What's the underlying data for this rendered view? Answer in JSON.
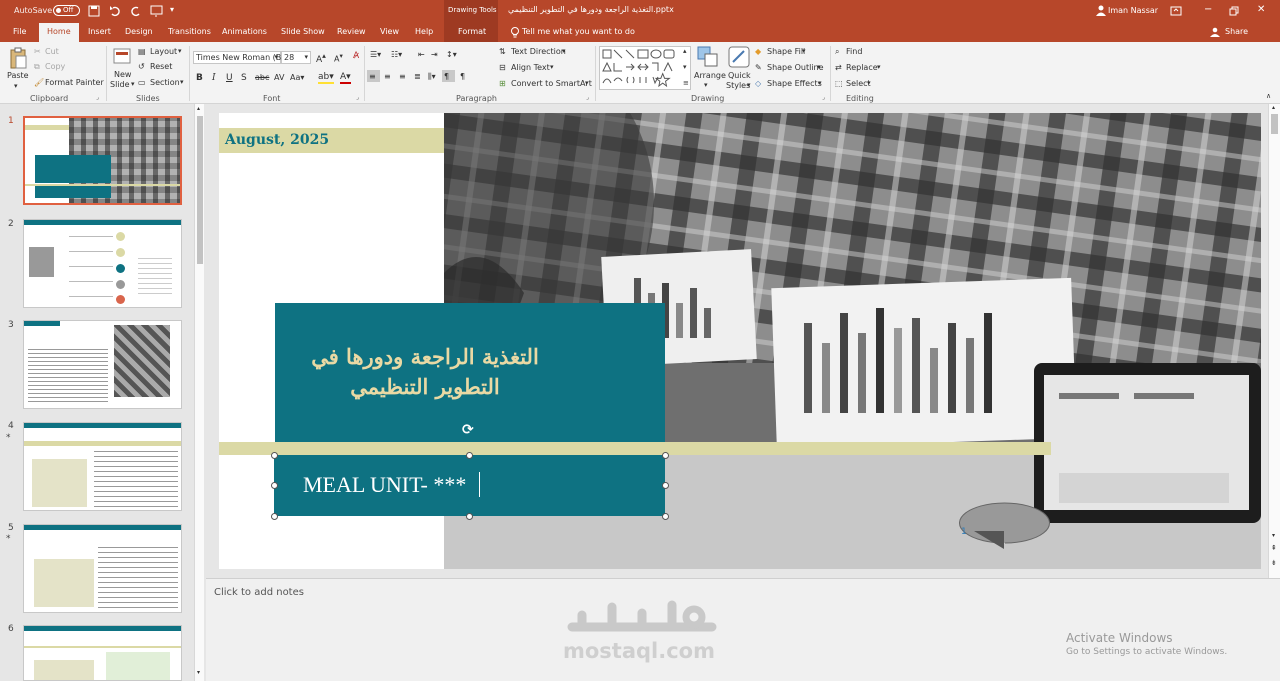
{
  "titlebar": {
    "autosave": "AutoSave",
    "autosave_state": "Off",
    "context_tools": "Drawing Tools",
    "filename": "التغذية الراجعة ودورها في التطوير التنظيمي.pptx",
    "user": "Iman Nassar"
  },
  "tabs": [
    "File",
    "Home",
    "Insert",
    "Design",
    "Transitions",
    "Animations",
    "Slide Show",
    "Review",
    "View",
    "Help",
    "Format"
  ],
  "tell_me": "Tell me what you want to do",
  "share": "Share",
  "ribbon": {
    "clipboard": {
      "paste": "Paste",
      "cut": "Cut",
      "copy": "Copy",
      "format_painter": "Format Painter",
      "label": "Clipboard"
    },
    "slides": {
      "new_slide": "New",
      "new_slide2": "Slide",
      "layout": "Layout",
      "reset": "Reset",
      "section": "Section",
      "label": "Slides"
    },
    "font": {
      "family": "Times New Roman (B",
      "size": "28",
      "label": "Font"
    },
    "paragraph": {
      "text_direction": "Text Direction",
      "align_text": "Align Text",
      "smartart": "Convert to SmartArt",
      "label": "Paragraph"
    },
    "drawing": {
      "arrange": "Arrange",
      "quick_styles": "Quick",
      "quick_styles2": "Styles",
      "shape_fill": "Shape Fill",
      "shape_outline": "Shape Outline",
      "shape_effects": "Shape Effects",
      "label": "Drawing"
    },
    "editing": {
      "find": "Find",
      "replace": "Replace",
      "select": "Select",
      "label": "Editing"
    }
  },
  "thumbnails": [
    {
      "num": "1",
      "star": ""
    },
    {
      "num": "2",
      "star": ""
    },
    {
      "num": "3",
      "star": ""
    },
    {
      "num": "4",
      "star": "*"
    },
    {
      "num": "5",
      "star": "*"
    },
    {
      "num": "6",
      "star": ""
    }
  ],
  "slide": {
    "date": "August, 2025",
    "title_line1": "التغذية الراجعة ودورها في",
    "title_line2": "التطوير التنظيمي",
    "subtitle": "MEAL UNIT- ***",
    "page_number": "1"
  },
  "colors": {
    "accent": "#b7472a",
    "teal": "#0e7282",
    "gold": "#dbd9a5",
    "title_text": "#e9d9a4"
  },
  "notes_placeholder": "Click to add notes",
  "watermark": {
    "arabic": "مستقل",
    "latin": "mostaql.com"
  },
  "activate": {
    "line1": "Activate Windows",
    "line2": "Go to Settings to activate Windows."
  }
}
